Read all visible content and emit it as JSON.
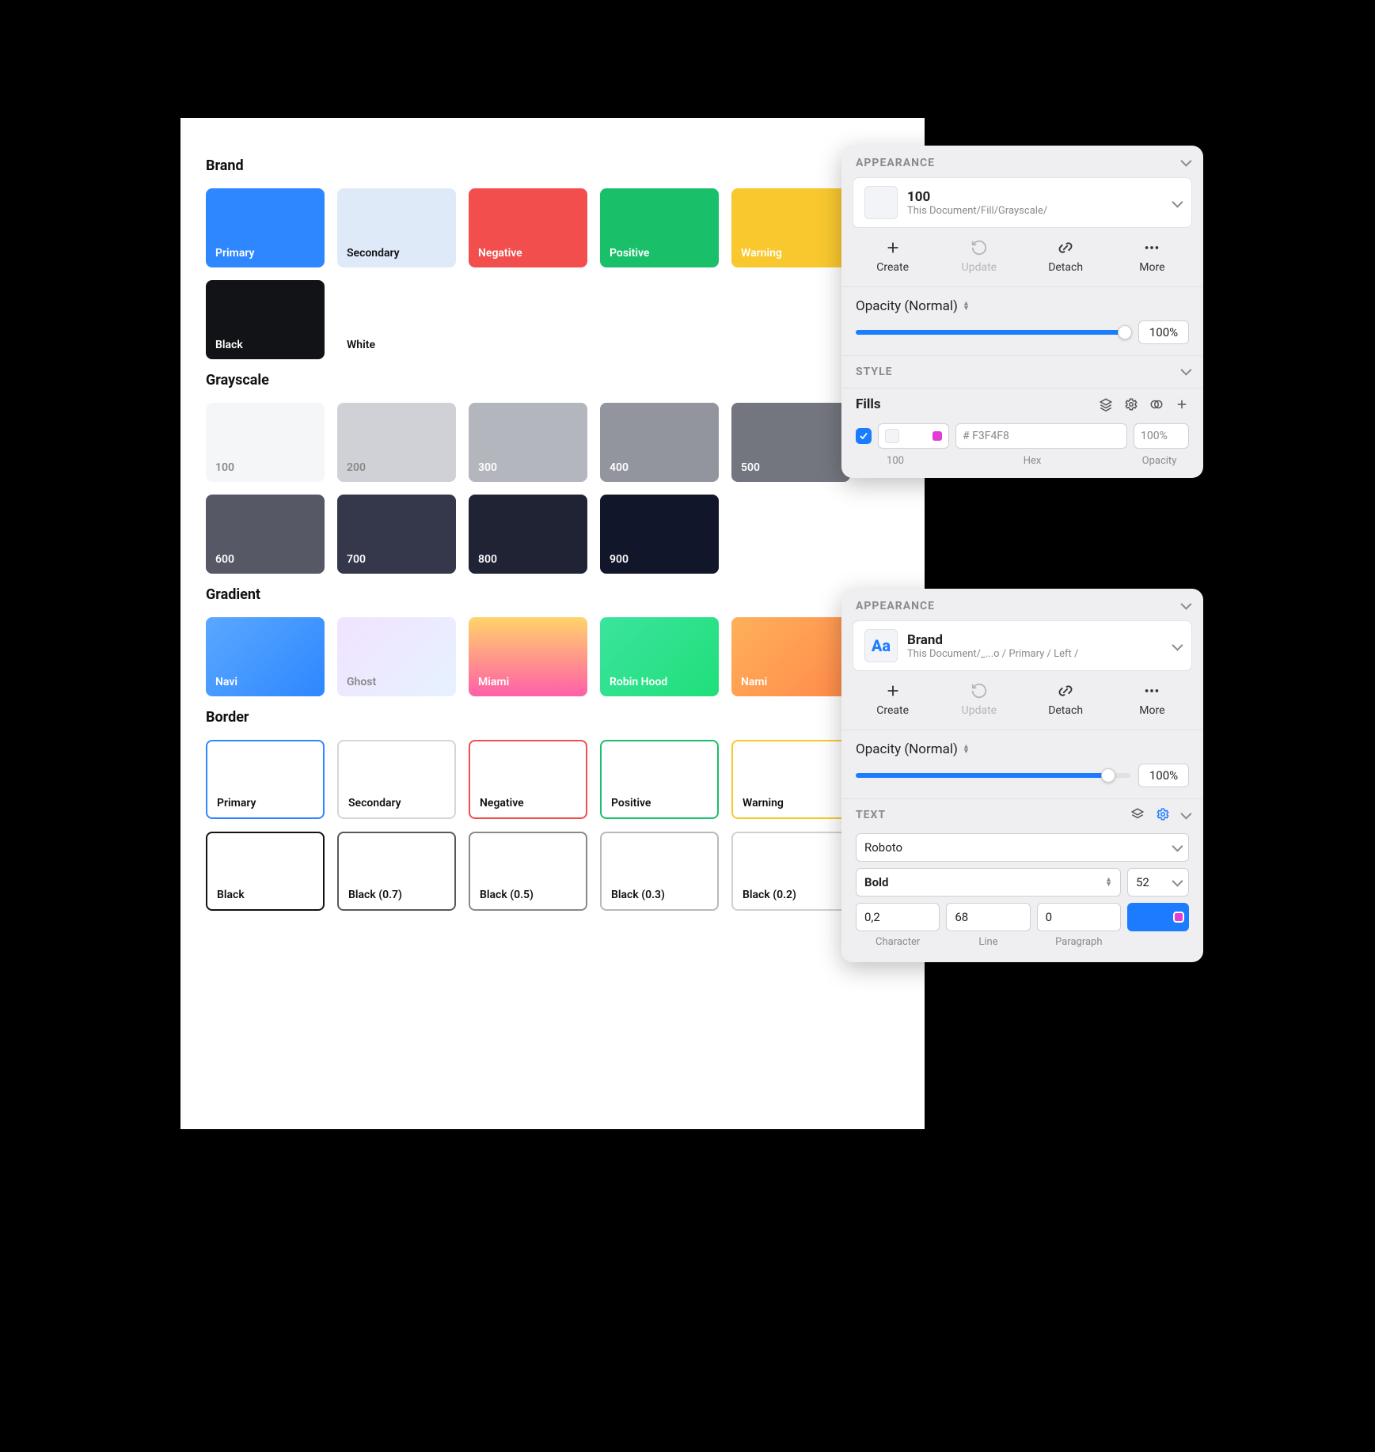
{
  "palette": {
    "sections": [
      {
        "title": "Brand",
        "rows": [
          [
            {
              "label": "Primary",
              "bg": "#2e87ff",
              "text": "light"
            },
            {
              "label": "Secondary",
              "bg": "#dfeaf9",
              "text": "dark"
            },
            {
              "label": "Negative",
              "bg": "#f24e4e",
              "text": "light"
            },
            {
              "label": "Positive",
              "bg": "#1ac069",
              "text": "light"
            },
            {
              "label": "Warning",
              "bg": "#f9c82f",
              "text": "light"
            }
          ],
          [
            {
              "label": "Black",
              "bg": "#111316",
              "text": "light"
            },
            {
              "label": "White",
              "bg": "#ffffff",
              "text": "dark",
              "bordered": false
            }
          ]
        ]
      },
      {
        "title": "Grayscale",
        "rows": [
          [
            {
              "label": "100",
              "bg": "#f5f6f8",
              "text": "grey"
            },
            {
              "label": "200",
              "bg": "#d0d1d6",
              "text": "grey"
            },
            {
              "label": "300",
              "bg": "#b4b6bd",
              "text": "light"
            },
            {
              "label": "400",
              "bg": "#93959e",
              "text": "light"
            },
            {
              "label": "500",
              "bg": "#74767f",
              "text": "light"
            }
          ],
          [
            {
              "label": "600",
              "bg": "#565965",
              "text": "light"
            },
            {
              "label": "700",
              "bg": "#34384a",
              "text": "light"
            },
            {
              "label": "800",
              "bg": "#1f2334",
              "text": "light"
            },
            {
              "label": "900",
              "bg": "#12162a",
              "text": "light"
            }
          ]
        ]
      },
      {
        "title": "Gradient",
        "rows": [
          [
            {
              "label": "Navi",
              "gradient": "linear-gradient(135deg,#5aa8ff,#2e87ff)",
              "text": "light"
            },
            {
              "label": "Ghost",
              "gradient": "linear-gradient(135deg,#f1e3ff,#e6f2ff)",
              "text": "grey"
            },
            {
              "label": "Miami",
              "gradient": "linear-gradient(180deg,#ffd36a,#ff5fa8)",
              "text": "light"
            },
            {
              "label": "Robin Hood",
              "gradient": "linear-gradient(135deg,#3be49d,#1fdf7a)",
              "text": "light"
            },
            {
              "label": "Nami",
              "gradient": "linear-gradient(135deg,#ffb05a,#ff8a4a)",
              "text": "light"
            }
          ]
        ]
      },
      {
        "title": "Border",
        "rows": [
          [
            {
              "label": "Primary",
              "border": "#2e87ff"
            },
            {
              "label": "Secondary",
              "border": "#d6d6da"
            },
            {
              "label": "Negative",
              "border": "#f24e4e"
            },
            {
              "label": "Positive",
              "border": "#1ac069"
            },
            {
              "label": "Warning",
              "border": "#f9c82f"
            }
          ],
          [
            {
              "label": "Black",
              "border": "#111316"
            },
            {
              "label": "Black (0.7)",
              "border": "rgba(17,19,22,0.7)"
            },
            {
              "label": "Black (0.5)",
              "border": "rgba(17,19,22,0.5)"
            },
            {
              "label": "Black (0.3)",
              "border": "rgba(17,19,22,0.3)"
            },
            {
              "label": "Black (0.2)",
              "border": "rgba(17,19,22,0.2)"
            }
          ]
        ]
      }
    ]
  },
  "panel1": {
    "header": "APPEARANCE",
    "card": {
      "title": "100",
      "subtitle": "This Document/Fill/Grayscale/"
    },
    "actions": [
      "Create",
      "Update",
      "Detach",
      "More"
    ],
    "opacity_label": "Opacity (Normal)",
    "opacity_value": "100%",
    "slider_fill_pct": 98,
    "style_header": "STYLE",
    "fills_title": "Fills",
    "fill_entry": {
      "name": "100",
      "hex_placeholder": "# F3F4F8",
      "opacity_placeholder": "100%"
    },
    "field_labels": [
      "100",
      "Hex",
      "Opacity"
    ]
  },
  "panel2": {
    "header": "APPEARANCE",
    "card": {
      "aa": "Aa",
      "title": "Brand",
      "subtitle": "This Document/_...o / Primary / Left /"
    },
    "actions": [
      "Create",
      "Update",
      "Detach",
      "More"
    ],
    "opacity_label": "Opacity (Normal)",
    "opacity_value": "100%",
    "slider_fill_pct": 92,
    "text_header": "TEXT",
    "font": "Roboto",
    "weight": "Bold",
    "size": "52",
    "metrics": {
      "character": "0,2",
      "line": "68",
      "paragraph": "0"
    },
    "metric_labels": [
      "Character",
      "Line",
      "Paragraph"
    ]
  }
}
